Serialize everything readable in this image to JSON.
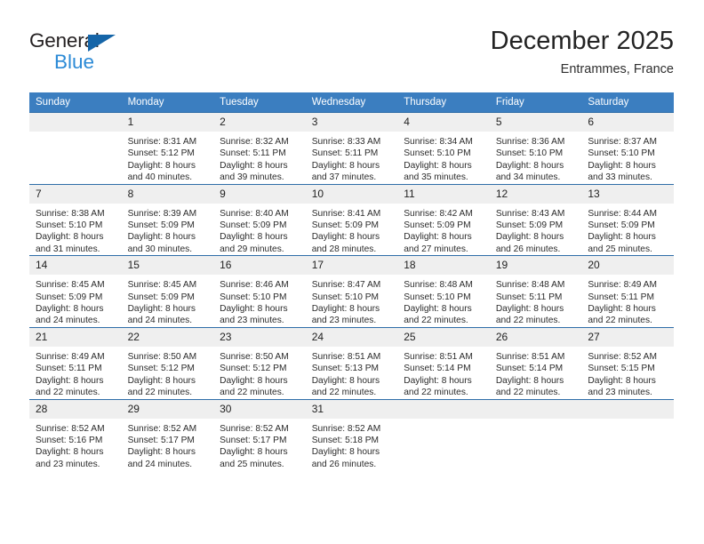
{
  "logo": {
    "text_top": "General",
    "text_bottom": "Blue",
    "triangle_color": "#1565a8",
    "blue_color": "#2b8ad6"
  },
  "header": {
    "month_title": "December 2025",
    "location": "Entrammes, France"
  },
  "theme": {
    "header_bg": "#3b7ec0",
    "row_divider": "#2e6da8",
    "daynum_bg": "#efefef"
  },
  "weekday_headers": [
    "Sunday",
    "Monday",
    "Tuesday",
    "Wednesday",
    "Thursday",
    "Friday",
    "Saturday"
  ],
  "weeks": [
    [
      {
        "day": "",
        "sunrise": "",
        "sunset": "",
        "daylight1": "",
        "daylight2": ""
      },
      {
        "day": "1",
        "sunrise": "Sunrise: 8:31 AM",
        "sunset": "Sunset: 5:12 PM",
        "daylight1": "Daylight: 8 hours",
        "daylight2": "and 40 minutes."
      },
      {
        "day": "2",
        "sunrise": "Sunrise: 8:32 AM",
        "sunset": "Sunset: 5:11 PM",
        "daylight1": "Daylight: 8 hours",
        "daylight2": "and 39 minutes."
      },
      {
        "day": "3",
        "sunrise": "Sunrise: 8:33 AM",
        "sunset": "Sunset: 5:11 PM",
        "daylight1": "Daylight: 8 hours",
        "daylight2": "and 37 minutes."
      },
      {
        "day": "4",
        "sunrise": "Sunrise: 8:34 AM",
        "sunset": "Sunset: 5:10 PM",
        "daylight1": "Daylight: 8 hours",
        "daylight2": "and 35 minutes."
      },
      {
        "day": "5",
        "sunrise": "Sunrise: 8:36 AM",
        "sunset": "Sunset: 5:10 PM",
        "daylight1": "Daylight: 8 hours",
        "daylight2": "and 34 minutes."
      },
      {
        "day": "6",
        "sunrise": "Sunrise: 8:37 AM",
        "sunset": "Sunset: 5:10 PM",
        "daylight1": "Daylight: 8 hours",
        "daylight2": "and 33 minutes."
      }
    ],
    [
      {
        "day": "7",
        "sunrise": "Sunrise: 8:38 AM",
        "sunset": "Sunset: 5:10 PM",
        "daylight1": "Daylight: 8 hours",
        "daylight2": "and 31 minutes."
      },
      {
        "day": "8",
        "sunrise": "Sunrise: 8:39 AM",
        "sunset": "Sunset: 5:09 PM",
        "daylight1": "Daylight: 8 hours",
        "daylight2": "and 30 minutes."
      },
      {
        "day": "9",
        "sunrise": "Sunrise: 8:40 AM",
        "sunset": "Sunset: 5:09 PM",
        "daylight1": "Daylight: 8 hours",
        "daylight2": "and 29 minutes."
      },
      {
        "day": "10",
        "sunrise": "Sunrise: 8:41 AM",
        "sunset": "Sunset: 5:09 PM",
        "daylight1": "Daylight: 8 hours",
        "daylight2": "and 28 minutes."
      },
      {
        "day": "11",
        "sunrise": "Sunrise: 8:42 AM",
        "sunset": "Sunset: 5:09 PM",
        "daylight1": "Daylight: 8 hours",
        "daylight2": "and 27 minutes."
      },
      {
        "day": "12",
        "sunrise": "Sunrise: 8:43 AM",
        "sunset": "Sunset: 5:09 PM",
        "daylight1": "Daylight: 8 hours",
        "daylight2": "and 26 minutes."
      },
      {
        "day": "13",
        "sunrise": "Sunrise: 8:44 AM",
        "sunset": "Sunset: 5:09 PM",
        "daylight1": "Daylight: 8 hours",
        "daylight2": "and 25 minutes."
      }
    ],
    [
      {
        "day": "14",
        "sunrise": "Sunrise: 8:45 AM",
        "sunset": "Sunset: 5:09 PM",
        "daylight1": "Daylight: 8 hours",
        "daylight2": "and 24 minutes."
      },
      {
        "day": "15",
        "sunrise": "Sunrise: 8:45 AM",
        "sunset": "Sunset: 5:09 PM",
        "daylight1": "Daylight: 8 hours",
        "daylight2": "and 24 minutes."
      },
      {
        "day": "16",
        "sunrise": "Sunrise: 8:46 AM",
        "sunset": "Sunset: 5:10 PM",
        "daylight1": "Daylight: 8 hours",
        "daylight2": "and 23 minutes."
      },
      {
        "day": "17",
        "sunrise": "Sunrise: 8:47 AM",
        "sunset": "Sunset: 5:10 PM",
        "daylight1": "Daylight: 8 hours",
        "daylight2": "and 23 minutes."
      },
      {
        "day": "18",
        "sunrise": "Sunrise: 8:48 AM",
        "sunset": "Sunset: 5:10 PM",
        "daylight1": "Daylight: 8 hours",
        "daylight2": "and 22 minutes."
      },
      {
        "day": "19",
        "sunrise": "Sunrise: 8:48 AM",
        "sunset": "Sunset: 5:11 PM",
        "daylight1": "Daylight: 8 hours",
        "daylight2": "and 22 minutes."
      },
      {
        "day": "20",
        "sunrise": "Sunrise: 8:49 AM",
        "sunset": "Sunset: 5:11 PM",
        "daylight1": "Daylight: 8 hours",
        "daylight2": "and 22 minutes."
      }
    ],
    [
      {
        "day": "21",
        "sunrise": "Sunrise: 8:49 AM",
        "sunset": "Sunset: 5:11 PM",
        "daylight1": "Daylight: 8 hours",
        "daylight2": "and 22 minutes."
      },
      {
        "day": "22",
        "sunrise": "Sunrise: 8:50 AM",
        "sunset": "Sunset: 5:12 PM",
        "daylight1": "Daylight: 8 hours",
        "daylight2": "and 22 minutes."
      },
      {
        "day": "23",
        "sunrise": "Sunrise: 8:50 AM",
        "sunset": "Sunset: 5:12 PM",
        "daylight1": "Daylight: 8 hours",
        "daylight2": "and 22 minutes."
      },
      {
        "day": "24",
        "sunrise": "Sunrise: 8:51 AM",
        "sunset": "Sunset: 5:13 PM",
        "daylight1": "Daylight: 8 hours",
        "daylight2": "and 22 minutes."
      },
      {
        "day": "25",
        "sunrise": "Sunrise: 8:51 AM",
        "sunset": "Sunset: 5:14 PM",
        "daylight1": "Daylight: 8 hours",
        "daylight2": "and 22 minutes."
      },
      {
        "day": "26",
        "sunrise": "Sunrise: 8:51 AM",
        "sunset": "Sunset: 5:14 PM",
        "daylight1": "Daylight: 8 hours",
        "daylight2": "and 22 minutes."
      },
      {
        "day": "27",
        "sunrise": "Sunrise: 8:52 AM",
        "sunset": "Sunset: 5:15 PM",
        "daylight1": "Daylight: 8 hours",
        "daylight2": "and 23 minutes."
      }
    ],
    [
      {
        "day": "28",
        "sunrise": "Sunrise: 8:52 AM",
        "sunset": "Sunset: 5:16 PM",
        "daylight1": "Daylight: 8 hours",
        "daylight2": "and 23 minutes."
      },
      {
        "day": "29",
        "sunrise": "Sunrise: 8:52 AM",
        "sunset": "Sunset: 5:17 PM",
        "daylight1": "Daylight: 8 hours",
        "daylight2": "and 24 minutes."
      },
      {
        "day": "30",
        "sunrise": "Sunrise: 8:52 AM",
        "sunset": "Sunset: 5:17 PM",
        "daylight1": "Daylight: 8 hours",
        "daylight2": "and 25 minutes."
      },
      {
        "day": "31",
        "sunrise": "Sunrise: 8:52 AM",
        "sunset": "Sunset: 5:18 PM",
        "daylight1": "Daylight: 8 hours",
        "daylight2": "and 26 minutes."
      },
      {
        "day": "",
        "sunrise": "",
        "sunset": "",
        "daylight1": "",
        "daylight2": ""
      },
      {
        "day": "",
        "sunrise": "",
        "sunset": "",
        "daylight1": "",
        "daylight2": ""
      },
      {
        "day": "",
        "sunrise": "",
        "sunset": "",
        "daylight1": "",
        "daylight2": ""
      }
    ]
  ]
}
